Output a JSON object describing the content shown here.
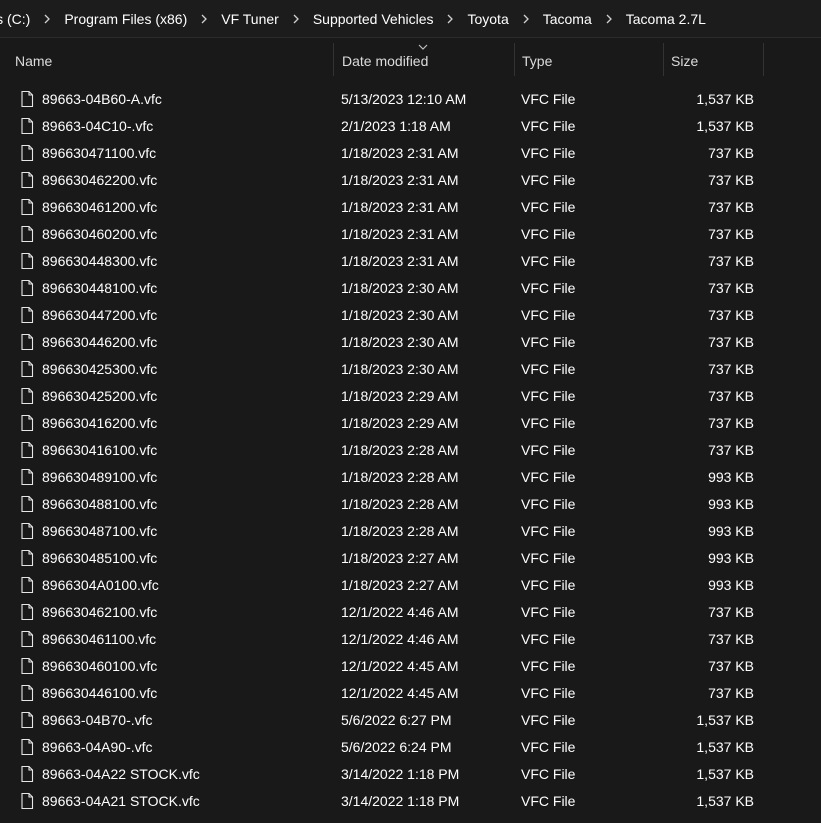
{
  "breadcrumb": [
    {
      "label": "ws (C:)"
    },
    {
      "label": "Program Files (x86)"
    },
    {
      "label": "VF Tuner"
    },
    {
      "label": "Supported Vehicles"
    },
    {
      "label": "Toyota"
    },
    {
      "label": "Tacoma"
    },
    {
      "label": "Tacoma 2.7L"
    }
  ],
  "columns": {
    "name": "Name",
    "date": "Date modified",
    "type": "Type",
    "size": "Size"
  },
  "files": [
    {
      "name": "89663-04B60-A.vfc",
      "date": "5/13/2023 12:10 AM",
      "type": "VFC File",
      "size": "1,537 KB"
    },
    {
      "name": "89663-04C10-.vfc",
      "date": "2/1/2023 1:18 AM",
      "type": "VFC File",
      "size": "1,537 KB"
    },
    {
      "name": "896630471100.vfc",
      "date": "1/18/2023 2:31 AM",
      "type": "VFC File",
      "size": "737 KB"
    },
    {
      "name": "896630462200.vfc",
      "date": "1/18/2023 2:31 AM",
      "type": "VFC File",
      "size": "737 KB"
    },
    {
      "name": "896630461200.vfc",
      "date": "1/18/2023 2:31 AM",
      "type": "VFC File",
      "size": "737 KB"
    },
    {
      "name": "896630460200.vfc",
      "date": "1/18/2023 2:31 AM",
      "type": "VFC File",
      "size": "737 KB"
    },
    {
      "name": "896630448300.vfc",
      "date": "1/18/2023 2:31 AM",
      "type": "VFC File",
      "size": "737 KB"
    },
    {
      "name": "896630448100.vfc",
      "date": "1/18/2023 2:30 AM",
      "type": "VFC File",
      "size": "737 KB"
    },
    {
      "name": "896630447200.vfc",
      "date": "1/18/2023 2:30 AM",
      "type": "VFC File",
      "size": "737 KB"
    },
    {
      "name": "896630446200.vfc",
      "date": "1/18/2023 2:30 AM",
      "type": "VFC File",
      "size": "737 KB"
    },
    {
      "name": "896630425300.vfc",
      "date": "1/18/2023 2:30 AM",
      "type": "VFC File",
      "size": "737 KB"
    },
    {
      "name": "896630425200.vfc",
      "date": "1/18/2023 2:29 AM",
      "type": "VFC File",
      "size": "737 KB"
    },
    {
      "name": "896630416200.vfc",
      "date": "1/18/2023 2:29 AM",
      "type": "VFC File",
      "size": "737 KB"
    },
    {
      "name": "896630416100.vfc",
      "date": "1/18/2023 2:28 AM",
      "type": "VFC File",
      "size": "737 KB"
    },
    {
      "name": "896630489100.vfc",
      "date": "1/18/2023 2:28 AM",
      "type": "VFC File",
      "size": "993 KB"
    },
    {
      "name": "896630488100.vfc",
      "date": "1/18/2023 2:28 AM",
      "type": "VFC File",
      "size": "993 KB"
    },
    {
      "name": "896630487100.vfc",
      "date": "1/18/2023 2:28 AM",
      "type": "VFC File",
      "size": "993 KB"
    },
    {
      "name": "896630485100.vfc",
      "date": "1/18/2023 2:27 AM",
      "type": "VFC File",
      "size": "993 KB"
    },
    {
      "name": "8966304A0100.vfc",
      "date": "1/18/2023 2:27 AM",
      "type": "VFC File",
      "size": "993 KB"
    },
    {
      "name": "896630462100.vfc",
      "date": "12/1/2022 4:46 AM",
      "type": "VFC File",
      "size": "737 KB"
    },
    {
      "name": "896630461100.vfc",
      "date": "12/1/2022 4:46 AM",
      "type": "VFC File",
      "size": "737 KB"
    },
    {
      "name": "896630460100.vfc",
      "date": "12/1/2022 4:45 AM",
      "type": "VFC File",
      "size": "737 KB"
    },
    {
      "name": "896630446100.vfc",
      "date": "12/1/2022 4:45 AM",
      "type": "VFC File",
      "size": "737 KB"
    },
    {
      "name": "89663-04B70-.vfc",
      "date": "5/6/2022 6:27 PM",
      "type": "VFC File",
      "size": "1,537 KB"
    },
    {
      "name": "89663-04A90-.vfc",
      "date": "5/6/2022 6:24 PM",
      "type": "VFC File",
      "size": "1,537 KB"
    },
    {
      "name": "89663-04A22 STOCK.vfc",
      "date": "3/14/2022 1:18 PM",
      "type": "VFC File",
      "size": "1,537 KB"
    },
    {
      "name": "89663-04A21 STOCK.vfc",
      "date": "3/14/2022 1:18 PM",
      "type": "VFC File",
      "size": "1,537 KB"
    }
  ],
  "icons": {
    "separator": "chevron-right-icon",
    "file": "file-icon",
    "sort": "chevron-up-icon"
  },
  "colors": {
    "background": "#191919",
    "text": "#ffffff"
  }
}
